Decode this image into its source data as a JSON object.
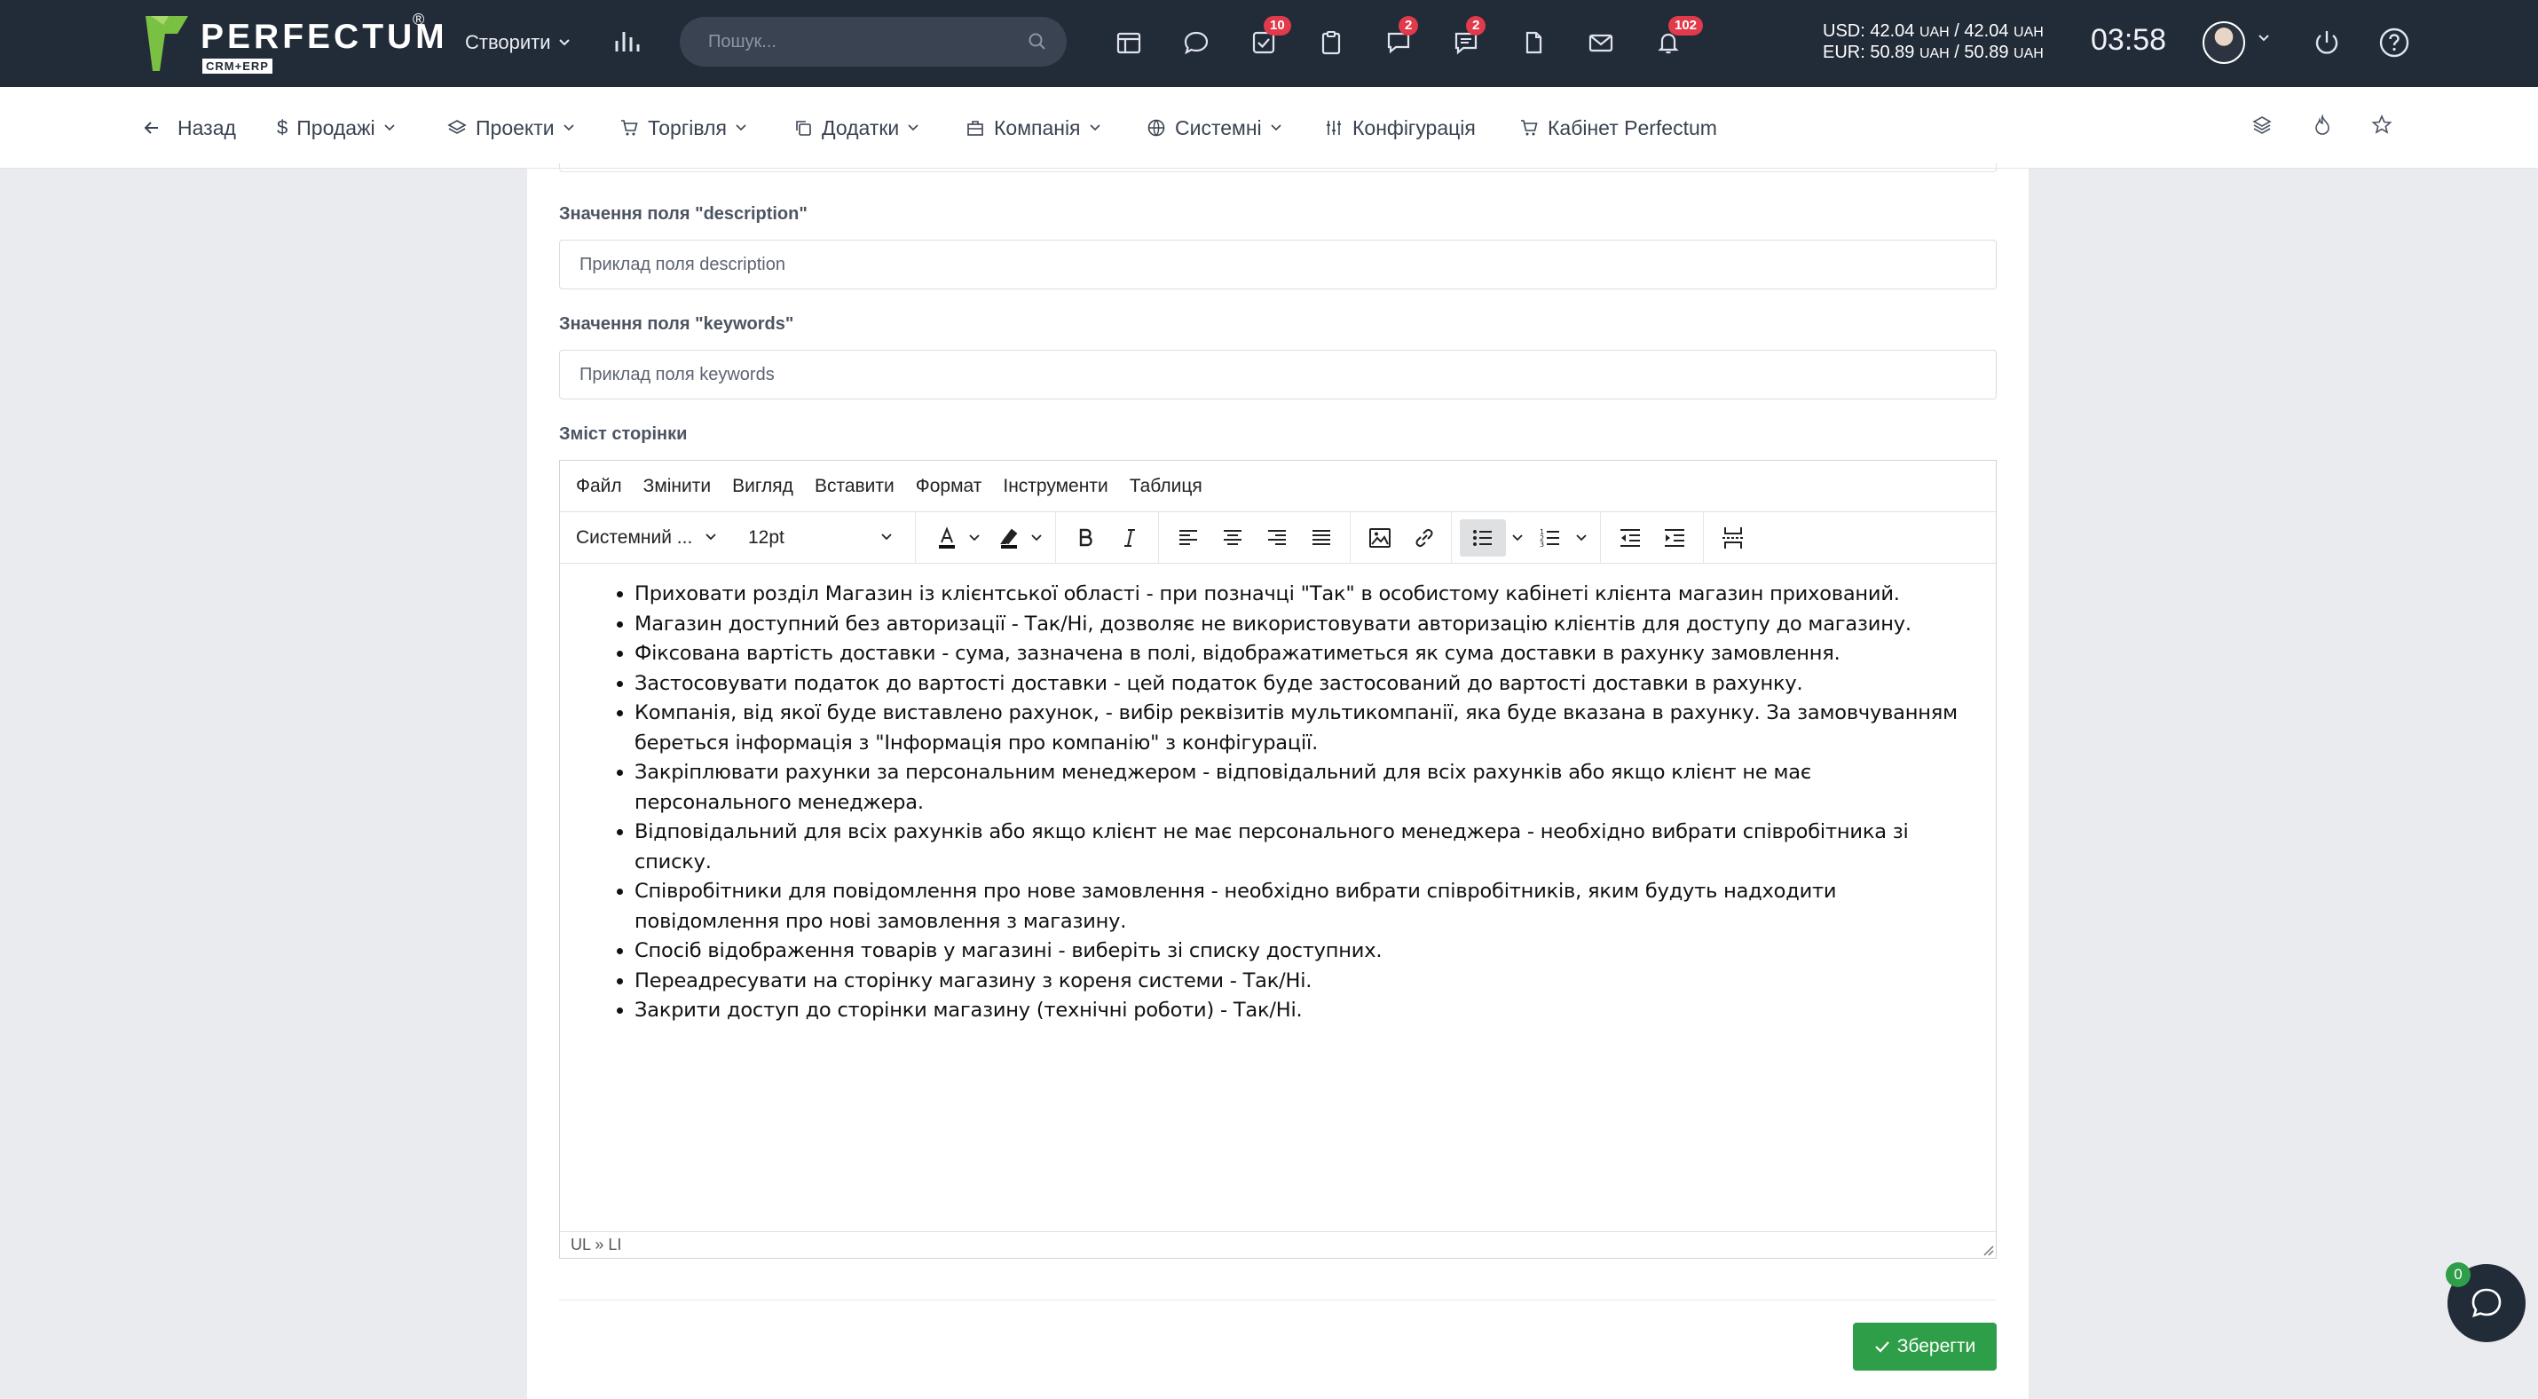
{
  "app": {
    "brand": "PERFECTUM",
    "brand_sub": "CRM+ERP",
    "brand_reg": "®"
  },
  "topbar": {
    "create_label": "Створити",
    "search_placeholder": "Пошук...",
    "badges": {
      "tasks": "10",
      "chat": "2",
      "messages": "2",
      "notifications": "102"
    },
    "usd_rate": "USD: 42.04",
    "usd_unit1": "UAH",
    "usd_sep": " / 42.04 ",
    "usd_unit2": "UAH",
    "eur_rate": "EUR: 50.89",
    "eur_unit1": "UAH",
    "eur_sep": " / 50.89 ",
    "eur_unit2": "UAH",
    "time": "03:58"
  },
  "nav": {
    "back": "Назад",
    "sales": "Продажі",
    "projects": "Проекти",
    "trade": "Торгівля",
    "addons": "Додатки",
    "company": "Компанія",
    "system": "Системні",
    "config": "Конфігурація",
    "cabinet": "Кабінет Perfectum"
  },
  "form": {
    "description_label": "Значення поля \"description\"",
    "description_value": "Приклад поля description",
    "keywords_label": "Значення поля \"keywords\"",
    "keywords_value": "Приклад поля keywords",
    "content_label": "Зміст сторінки"
  },
  "editor": {
    "menu": [
      "Файл",
      "Змінити",
      "Вигляд",
      "Вставити",
      "Формат",
      "Інструменти",
      "Таблиця"
    ],
    "font_family": "Системний ...",
    "font_size": "12pt",
    "items": [
      "Приховати розділ Магазин із клієнтської області - при позначці \"Так\" в особистому кабінеті клієнта магазин прихований.",
      "Магазин доступний без авторизації - Так/Ні, дозволяє не використовувати авторизацію клієнтів для доступу до магазину.",
      "Фіксована вартість доставки - сума, зазначена в полі, відображатиметься як сума доставки в рахунку замовлення.",
      "Застосовувати податок до вартості доставки - цей податок буде застосований до вартості доставки в рахунку.",
      "Компанія, від якої буде виставлено рахунок, - вибір реквізитів мультикомпанії, яка буде вказана в рахунку. За замовчуванням береться інформація з \"Інформація про компанію\" з конфігурації.",
      "Закріплювати рахунки за персональним менеджером - відповідальний для всіх рахунків або якщо клієнт не має персонального менеджера.",
      "Відповідальний для всіх рахунків або якщо клієнт не має персонального менеджера - необхідно вибрати співробітника зі списку.",
      "Співробітники для повідомлення про нове замовлення - необхідно вибрати співробітників, яким будуть надходити повідомлення про нові замовлення з магазину.",
      "Спосіб відображення товарів у магазині - виберіть зі списку доступних.",
      "Переадресувати на сторінку магазину з кореня системи - Так/Ні.",
      "Закрити доступ до сторінки магазину (технічні роботи) - Так/Ні."
    ],
    "status_path": "UL » LI"
  },
  "actions": {
    "save_label": "Зберегти"
  },
  "chat": {
    "unread": "0"
  },
  "colors": {
    "topbar_bg": "#222b38",
    "badge": "#e03a4b",
    "save": "#2e9e48",
    "page_bg": "#e9ebef"
  }
}
